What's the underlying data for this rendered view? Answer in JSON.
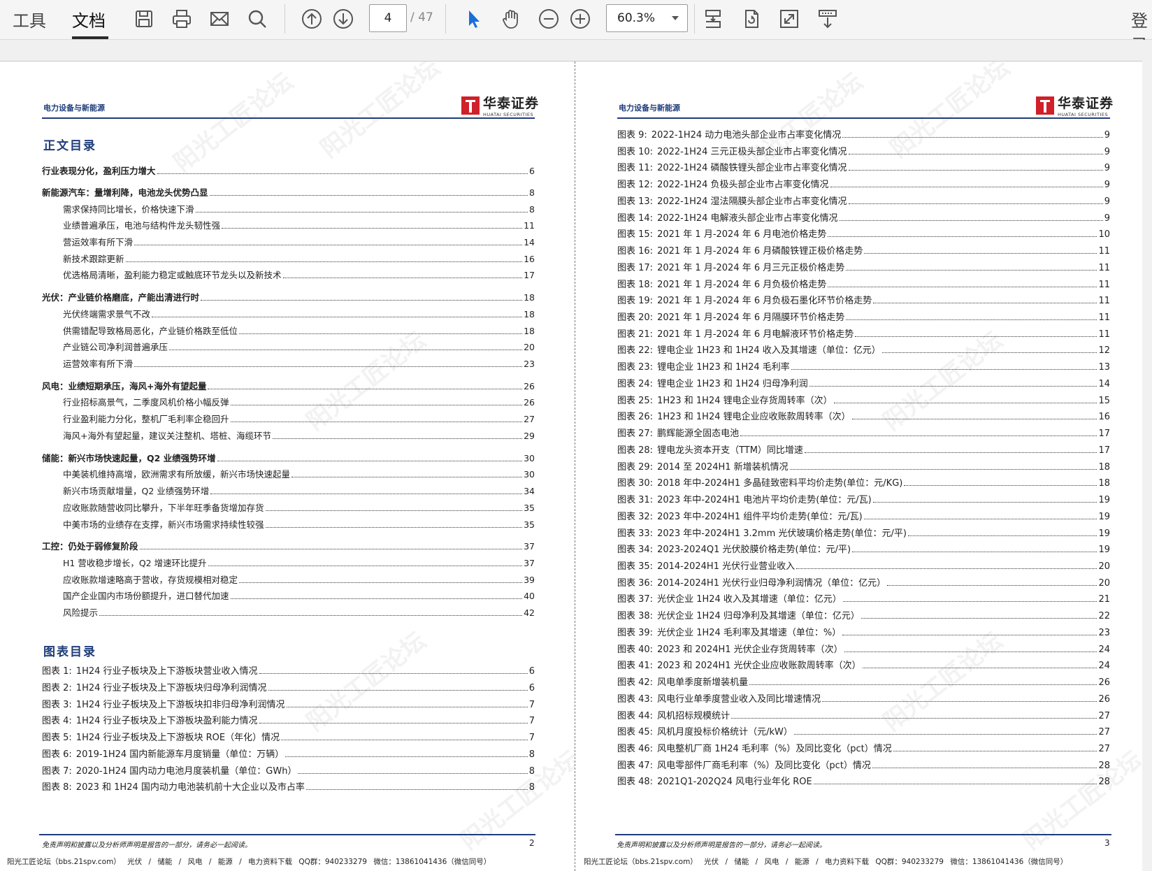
{
  "toolbar": {
    "tabs": [
      "工具",
      "文档"
    ],
    "active_tab": "文档",
    "current_page": "4",
    "total_pages": "/ 47",
    "zoom": "60.3%",
    "login": "登录",
    "icons": [
      "save-icon",
      "print-icon",
      "mail-icon",
      "search-icon",
      "prev-page-icon",
      "next-page-icon",
      "select-cursor-icon",
      "hand-tool-icon",
      "zoom-out-icon",
      "zoom-in-icon",
      "fit-page-icon",
      "rotate-icon",
      "fullscreen-icon",
      "page-layout-icon"
    ]
  },
  "header": {
    "sector": "电力设备与新能源",
    "brand_cn": "华泰证券",
    "brand_en": "HUATAI SECURITIES",
    "brand_color": "#d0202a",
    "accent_color": "#1f3d7a"
  },
  "left_page": {
    "toc_title": "正文目录",
    "toc": [
      {
        "text": "行业表现分化，盈利压力增大",
        "page": "6",
        "level": 1
      },
      {
        "text": "新能源汽车：量增利降，电池龙头优势凸显",
        "page": "8",
        "level": 1
      },
      {
        "text": "需求保持同比增长，价格快速下滑",
        "page": "8",
        "level": 2
      },
      {
        "text": "业绩普遍承压，电池与结构件龙头韧性强",
        "page": "11",
        "level": 2
      },
      {
        "text": "营运效率有所下滑",
        "page": "14",
        "level": 2
      },
      {
        "text": "新技术跟踪更新",
        "page": "16",
        "level": 2
      },
      {
        "text": "优选格局清晰，盈利能力稳定或触底环节龙头以及新技术",
        "page": "17",
        "level": 2
      },
      {
        "text": "光伏：产业链价格磨底，产能出清进行时",
        "page": "18",
        "level": 1
      },
      {
        "text": "光伏终端需求景气不改",
        "page": "18",
        "level": 2
      },
      {
        "text": "供需错配导致格局恶化，产业链价格跌至低位",
        "page": "18",
        "level": 2
      },
      {
        "text": "产业链公司净利润普遍承压",
        "page": "20",
        "level": 2
      },
      {
        "text": "运营效率有所下滑",
        "page": "23",
        "level": 2
      },
      {
        "text": "风电：业绩短期承压，海风+海外有望起量",
        "page": "26",
        "level": 1
      },
      {
        "text": "行业招标高景气，二季度风机价格小幅反弹",
        "page": "26",
        "level": 2
      },
      {
        "text": "行业盈利能力分化，整机厂毛利率企稳回升",
        "page": "27",
        "level": 2
      },
      {
        "text": "海风+海外有望起量，建议关注整机、塔桩、海缆环节",
        "page": "29",
        "level": 2
      },
      {
        "text": "储能：新兴市场快速起量，Q2 业绩强势环增",
        "page": "30",
        "level": 1
      },
      {
        "text": "中美装机维持高增，欧洲需求有所放缓，新兴市场快速起量",
        "page": "30",
        "level": 2
      },
      {
        "text": "新兴市场贡献增量，Q2 业绩强势环增",
        "page": "34",
        "level": 2
      },
      {
        "text": "应收账款随营收同比攀升，下半年旺季备货增加存货",
        "page": "35",
        "level": 2
      },
      {
        "text": "中美市场的业绩存在支撑，新兴市场需求持续性较强",
        "page": "35",
        "level": 2
      },
      {
        "text": "工控：仍处于弱修复阶段",
        "page": "37",
        "level": 1
      },
      {
        "text": "H1 营收稳步增长，Q2 增速环比提升",
        "page": "37",
        "level": 2
      },
      {
        "text": "应收账款增速略高于营收，存货规模相对稳定",
        "page": "39",
        "level": 2
      },
      {
        "text": "国产企业国内市场份额提升，进口替代加速",
        "page": "40",
        "level": 2
      },
      {
        "text": "风险提示",
        "page": "42",
        "level": 2
      }
    ],
    "fig_title": "图表目录",
    "figures": [
      {
        "label": "图表 1:",
        "text": "1H24 行业子板块及上下游板块营业收入情况",
        "page": "6"
      },
      {
        "label": "图表 2:",
        "text": "1H24 行业子板块及上下游板块归母净利润情况",
        "page": "6"
      },
      {
        "label": "图表 3:",
        "text": "1H24 行业子板块及上下游板块扣非归母净利润情况",
        "page": "7"
      },
      {
        "label": "图表 4:",
        "text": "1H24 行业子板块及上下游板块盈利能力情况",
        "page": "7"
      },
      {
        "label": "图表 5:",
        "text": "1H24 行业子板块及上下游板块 ROE（年化）情况",
        "page": "7"
      },
      {
        "label": "图表 6:",
        "text": "2019-1H24 国内新能源车月度销量（单位：万辆）",
        "page": "8"
      },
      {
        "label": "图表 7:",
        "text": "2020-1H24 国内动力电池月度装机量（单位：GWh）",
        "page": "8"
      },
      {
        "label": "图表 8:",
        "text": "2023 和 1H24 国内动力电池装机前十大企业以及市占率",
        "page": "8"
      }
    ],
    "footer_disclaimer": "免责声明和披露以及分析师声明是报告的一部分，请务必一起阅读。",
    "footer_page": "2",
    "footer_forum": "阳光工匠论坛（bbs.21spv.com） 光伏 / 储能 / 风电 / 能源 / 电力资料下载 QQ群：940233279 微信：13861041436（微信同号）"
  },
  "right_page": {
    "figures": [
      {
        "label": "图表 9:",
        "text": "2022-1H24 动力电池头部企业市占率变化情况",
        "page": "9"
      },
      {
        "label": "图表 10:",
        "text": "2022-1H24 三元正极头部企业市占率变化情况",
        "page": "9"
      },
      {
        "label": "图表 11:",
        "text": "2022-1H24 磷酸铁锂头部企业市占率变化情况",
        "page": "9"
      },
      {
        "label": "图表 12:",
        "text": "2022-1H24 负极头部企业市占率变化情况",
        "page": "9"
      },
      {
        "label": "图表 13:",
        "text": "2022-1H24 湿法隔膜头部企业市占率变化情况",
        "page": "9"
      },
      {
        "label": "图表 14:",
        "text": "2022-1H24 电解液头部企业市占率变化情况",
        "page": "9"
      },
      {
        "label": "图表 15:",
        "text": "2021 年 1 月-2024 年 6 月电池价格走势",
        "page": "10"
      },
      {
        "label": "图表 16:",
        "text": "2021 年 1 月-2024 年 6 月磷酸铁锂正极价格走势",
        "page": "11"
      },
      {
        "label": "图表 17:",
        "text": "2021 年 1 月-2024 年 6 月三元正极价格走势",
        "page": "11"
      },
      {
        "label": "图表 18:",
        "text": "2021 年 1 月-2024 年 6 月负极价格走势",
        "page": "11"
      },
      {
        "label": "图表 19:",
        "text": "2021 年 1 月-2024 年 6 月负极石墨化环节价格走势",
        "page": "11"
      },
      {
        "label": "图表 20:",
        "text": "2021 年 1 月-2024 年 6 月隔膜环节价格走势",
        "page": "11"
      },
      {
        "label": "图表 21:",
        "text": "2021 年 1 月-2024 年 6 月电解液环节价格走势",
        "page": "11"
      },
      {
        "label": "图表 22:",
        "text": "锂电企业 1H23 和 1H24 收入及其增速（单位：亿元）",
        "page": "12"
      },
      {
        "label": "图表 23:",
        "text": "锂电企业 1H23 和 1H24 毛利率",
        "page": "13"
      },
      {
        "label": "图表 24:",
        "text": "锂电企业 1H23 和 1H24 归母净利润",
        "page": "14"
      },
      {
        "label": "图表 25:",
        "text": "1H23 和 1H24 锂电企业存货周转率（次）",
        "page": "15"
      },
      {
        "label": "图表 26:",
        "text": "1H23 和 1H24 锂电企业应收账款周转率（次）",
        "page": "16"
      },
      {
        "label": "图表 27:",
        "text": "鹏辉能源全固态电池",
        "page": "17"
      },
      {
        "label": "图表 28:",
        "text": "锂电龙头资本开支（TTM）同比增速",
        "page": "17"
      },
      {
        "label": "图表 29:",
        "text": "2014 至 2024H1 新增装机情况",
        "page": "18"
      },
      {
        "label": "图表 30:",
        "text": "2018 年中-2024H1 多晶硅致密料平均价走势(单位：元/KG)",
        "page": "18"
      },
      {
        "label": "图表 31:",
        "text": "2023 年中-2024H1 电池片平均价走势(单位：元/瓦)",
        "page": "19"
      },
      {
        "label": "图表 32:",
        "text": "2023 年中-2024H1 组件平均价走势(单位：元/瓦)",
        "page": "19"
      },
      {
        "label": "图表 33:",
        "text": "2023 年中-2024H1 3.2mm 光伏玻璃价格走势(单位：元/平)",
        "page": "19"
      },
      {
        "label": "图表 34:",
        "text": "2023-2024Q1 光伏胶膜价格走势(单位：元/平)",
        "page": "19"
      },
      {
        "label": "图表 35:",
        "text": "2014-2024H1 光伏行业营业收入",
        "page": "20"
      },
      {
        "label": "图表 36:",
        "text": "2014-2024H1 光伏行业归母净利润情况（单位：亿元）",
        "page": "20"
      },
      {
        "label": "图表 37:",
        "text": "光伏企业 1H24 收入及其增速（单位：亿元）",
        "page": "21"
      },
      {
        "label": "图表 38:",
        "text": "光伏企业 1H24 归母净利及其增速（单位：亿元）",
        "page": "22"
      },
      {
        "label": "图表 39:",
        "text": "光伏企业 1H24 毛利率及其增速（单位：%）",
        "page": "23"
      },
      {
        "label": "图表 40:",
        "text": "2023 和 2024H1 光伏企业存货周转率（次）",
        "page": "24"
      },
      {
        "label": "图表 41:",
        "text": "2023 和 2024H1 光伏企业应收账款周转率（次）",
        "page": "24"
      },
      {
        "label": "图表 42:",
        "text": "风电单季度新增装机量",
        "page": "26"
      },
      {
        "label": "图表 43:",
        "text": "风电行业单季度营业收入及同比增速情况",
        "page": "26"
      },
      {
        "label": "图表 44:",
        "text": "风机招标规模统计",
        "page": "27"
      },
      {
        "label": "图表 45:",
        "text": "风机月度投标价格统计（元/kW）",
        "page": "27"
      },
      {
        "label": "图表 46:",
        "text": "风电整机厂商 1H24 毛利率（%）及同比变化（pct）情况",
        "page": "27"
      },
      {
        "label": "图表 47:",
        "text": "风电零部件厂商毛利率（%）及同比变化（pct）情况",
        "page": "28"
      },
      {
        "label": "图表 48:",
        "text": "2021Q1-202Q24 风电行业年化 ROE",
        "page": "28"
      }
    ],
    "footer_disclaimer": "免责声明和披露以及分析师声明是报告的一部分，请务必一起阅读。",
    "footer_page": "3",
    "footer_forum": "阳光工匠论坛（bbs.21spv.com） 光伏 / 储能 / 风电 / 能源 / 电力资料下载 QQ群：940233279 微信：13861041436（微信同号）"
  },
  "watermark": "阳光工匠论坛"
}
